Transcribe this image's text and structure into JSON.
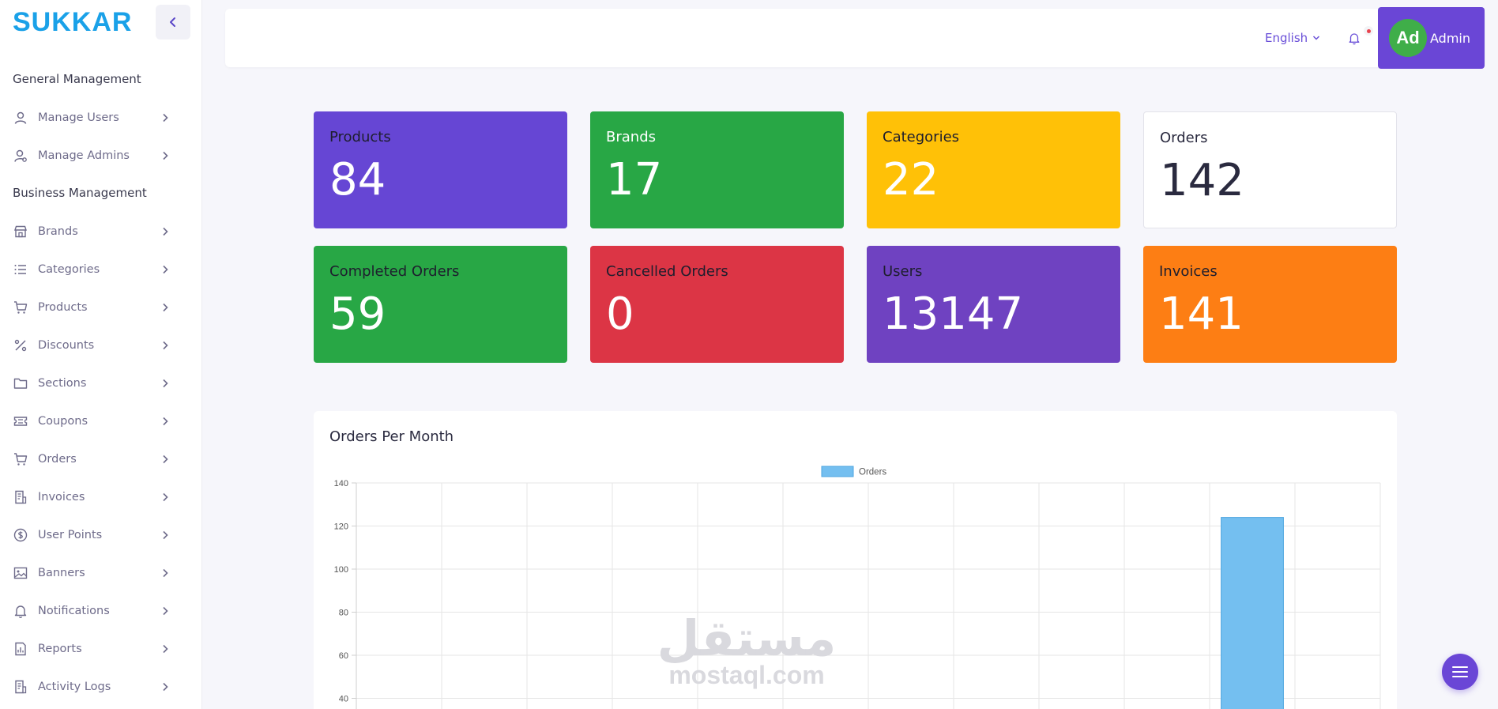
{
  "sidebar": {
    "logo": "SUKKAR",
    "sections": [
      {
        "title": "General Management",
        "items": [
          {
            "label": "Manage Users",
            "icon": "user-icon"
          },
          {
            "label": "Manage Admins",
            "icon": "admin-user-icon"
          }
        ]
      },
      {
        "title": "Business Management",
        "items": [
          {
            "label": "Brands",
            "icon": "store-icon"
          },
          {
            "label": "Categories",
            "icon": "list-icon"
          },
          {
            "label": "Products",
            "icon": "cart-icon"
          },
          {
            "label": "Discounts",
            "icon": "percent-icon"
          },
          {
            "label": "Sections",
            "icon": "folder-icon"
          },
          {
            "label": "Coupons",
            "icon": "ticket-icon"
          },
          {
            "label": "Orders",
            "icon": "cart-icon"
          },
          {
            "label": "Invoices",
            "icon": "invoice-icon"
          },
          {
            "label": "User Points",
            "icon": "dollar-circle-icon"
          },
          {
            "label": "Banners",
            "icon": "image-icon"
          },
          {
            "label": "Notifications",
            "icon": "bell-icon"
          },
          {
            "label": "Reports",
            "icon": "report-icon"
          },
          {
            "label": "Activity Logs",
            "icon": "log-icon"
          }
        ]
      }
    ]
  },
  "topbar": {
    "language": "English",
    "avatar_initials": "Ad",
    "admin_name": "Admin"
  },
  "stats": [
    {
      "label": "Products",
      "value": "84",
      "color": "#6646d4"
    },
    {
      "label": "Brands",
      "value": "17",
      "color": "#28a745"
    },
    {
      "label": "Categories",
      "value": "22",
      "color": "#ffc107"
    },
    {
      "label": "Orders",
      "value": "142",
      "color": "#ffffff"
    },
    {
      "label": "Completed Orders",
      "value": "59",
      "color": "#28a745"
    },
    {
      "label": "Cancelled Orders",
      "value": "0",
      "color": "#dc3545"
    },
    {
      "label": "Users",
      "value": "13147",
      "color": "#6f42c1"
    },
    {
      "label": "Invoices",
      "value": "141",
      "color": "#fd7e14"
    }
  ],
  "chart": {
    "title": "Orders Per Month"
  },
  "chart_data": {
    "type": "bar",
    "legend": "Orders",
    "legend_position": "top-center",
    "series": [
      {
        "name": "Orders",
        "values": [
          0,
          0,
          0,
          0,
          0,
          0,
          0,
          0,
          0,
          0,
          124,
          0
        ],
        "color": "#74bff0"
      }
    ],
    "ylim": [
      40,
      140
    ],
    "yticks": [
      140,
      120,
      100,
      80,
      60,
      40
    ],
    "grid": true
  },
  "watermark": {
    "arabic": "مستقل",
    "latin": "mostaql.com"
  },
  "colors": {
    "accent": "#6a46d6",
    "logo": "#1aa1e8",
    "nav_text": "#6e6b8a"
  }
}
